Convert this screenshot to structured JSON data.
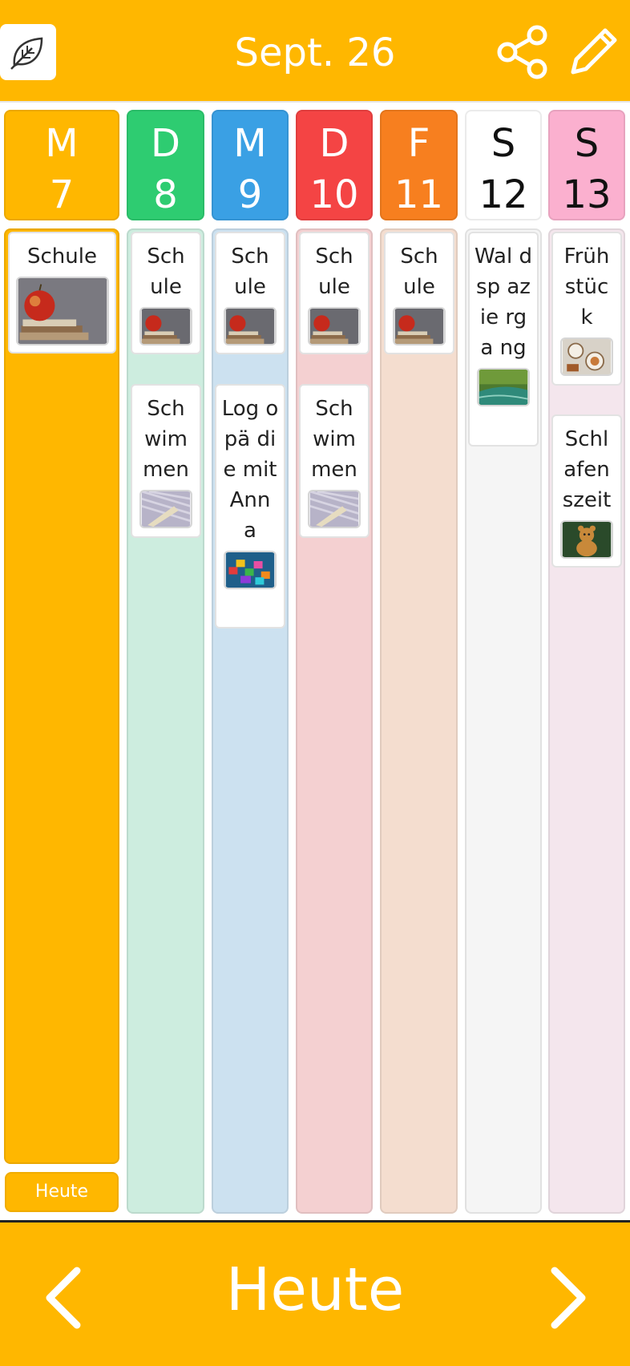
{
  "header": {
    "title": "Sept. 26",
    "logo_icon": "leaf-icon",
    "share_icon": "share-icon",
    "edit_icon": "pencil-icon"
  },
  "days": [
    {
      "letter": "M",
      "number": "7",
      "color": "#FFB700",
      "body_color": "#FFB700",
      "text_color": "#ffffff"
    },
    {
      "letter": "D",
      "number": "8",
      "color": "#2ECC71",
      "body_color": "#CDEDDF",
      "text_color": "#ffffff"
    },
    {
      "letter": "M",
      "number": "9",
      "color": "#3AA0E4",
      "body_color": "#CCE1F0",
      "text_color": "#ffffff"
    },
    {
      "letter": "D",
      "number": "10",
      "color": "#F44444",
      "body_color": "#F4D0D1",
      "text_color": "#ffffff"
    },
    {
      "letter": "F",
      "number": "11",
      "color": "#F77F1F",
      "body_color": "#F4DDCF",
      "text_color": "#ffffff"
    },
    {
      "letter": "S",
      "number": "12",
      "color": "#FFFFFF",
      "body_color": "#F5F5F5",
      "text_color": "#111111"
    },
    {
      "letter": "S",
      "number": "13",
      "color": "#FBB0CF",
      "body_color": "#F4E6ED",
      "text_color": "#111111"
    }
  ],
  "events": {
    "mon": [
      "Schule"
    ],
    "tue": [
      "Sch ule",
      "Sch wim men"
    ],
    "wed": [
      "Sch ule",
      "Log opä die mit Ann a"
    ],
    "thu": [
      "Sch ule",
      "Sch wim men"
    ],
    "fri": [
      "Sch ule"
    ],
    "sat": [
      "Wal dsp azie rga ng"
    ],
    "sun": [
      "Früh stüc k",
      "Schl afen szeit"
    ]
  },
  "today_chip": "Heute",
  "footer": {
    "label": "Heute",
    "prev_icon": "chevron-left-icon",
    "next_icon": "chevron-right-icon"
  }
}
